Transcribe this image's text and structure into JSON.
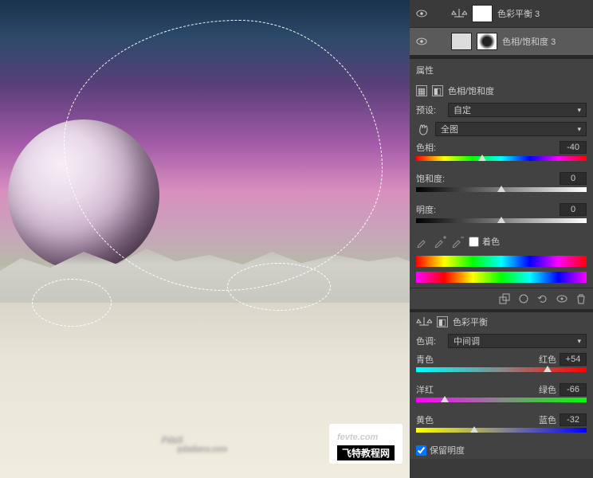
{
  "layers": {
    "row1": {
      "name": "色彩平衡 3"
    },
    "row2": {
      "name": "色相/饱和度 3"
    }
  },
  "properties": {
    "tab": "属性",
    "huesat": {
      "title": "色相/饱和度",
      "preset_label": "预设:",
      "preset_value": "自定",
      "range_value": "全图",
      "hue_label": "色相:",
      "hue_value": "-40",
      "sat_label": "饱和度:",
      "sat_value": "0",
      "light_label": "明度:",
      "light_value": "0",
      "colorize": "着色"
    }
  },
  "colorbalance": {
    "title": "色彩平衡",
    "tone_label": "色调:",
    "tone_value": "中间调",
    "cyan": "青色",
    "red": "红色",
    "cr_val": "+54",
    "magenta": "洋红",
    "green": "绿色",
    "mg_val": "-66",
    "yellow": "黄色",
    "blue": "蓝色",
    "yb_val": "-32",
    "preserve": "保留明度"
  },
  "watermark": {
    "main": "PdaS",
    "sub": "pdadians.com"
  },
  "logo": {
    "main": "fevte.com",
    "sub": "飞特教程网"
  }
}
